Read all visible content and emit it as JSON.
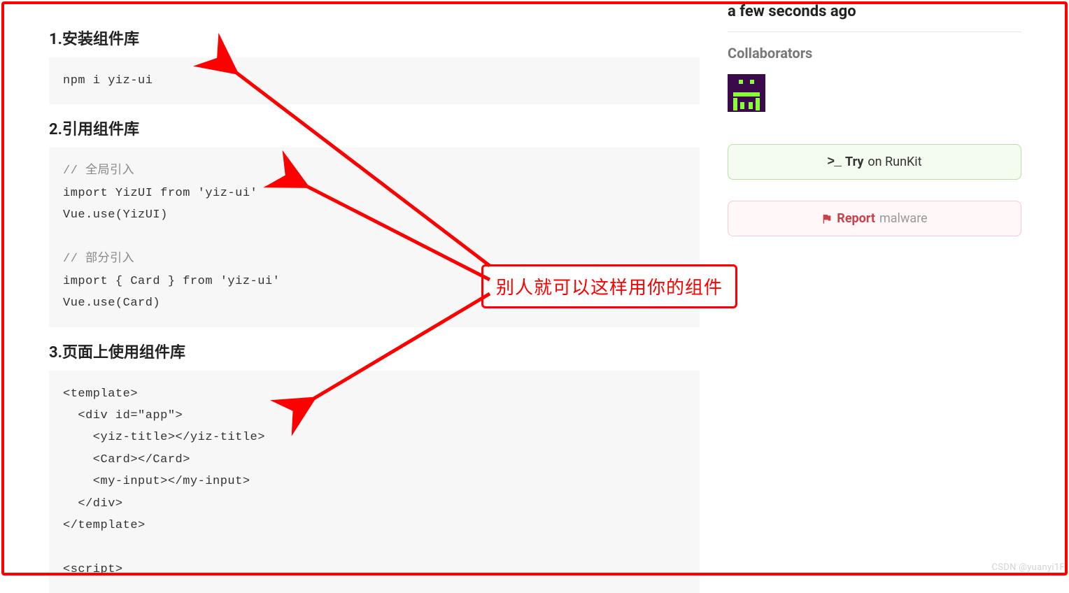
{
  "sections": {
    "s1": {
      "title": "1.安装组件库",
      "code": "npm i yiz-ui"
    },
    "s2": {
      "title": "2.引用组件库",
      "comment1": "// 全局引入",
      "line1": "import YizUI from 'yiz-ui'",
      "line2": "Vue.use(YizUI)",
      "comment2": "// 部分引入",
      "line3": "import { Card } from 'yiz-ui'",
      "line4": "Vue.use(Card)"
    },
    "s3": {
      "title": "3.页面上使用组件库",
      "code": "<template>\n  <div id=\"app\">\n    <yiz-title></yiz-title>\n    <Card></Card>\n    <my-input></my-input>\n  </div>\n</template>\n\n<script>"
    }
  },
  "sidebar": {
    "published": "a few seconds ago",
    "collaborators_label": "Collaborators",
    "try_prefix": ">_",
    "try_bold": "Try",
    "try_rest": " on RunKit",
    "report_bold": "Report",
    "report_rest": " malware"
  },
  "annotation": {
    "text": "别人就可以这样用你的组件"
  },
  "watermark": "CSDN @yuanyi1F"
}
